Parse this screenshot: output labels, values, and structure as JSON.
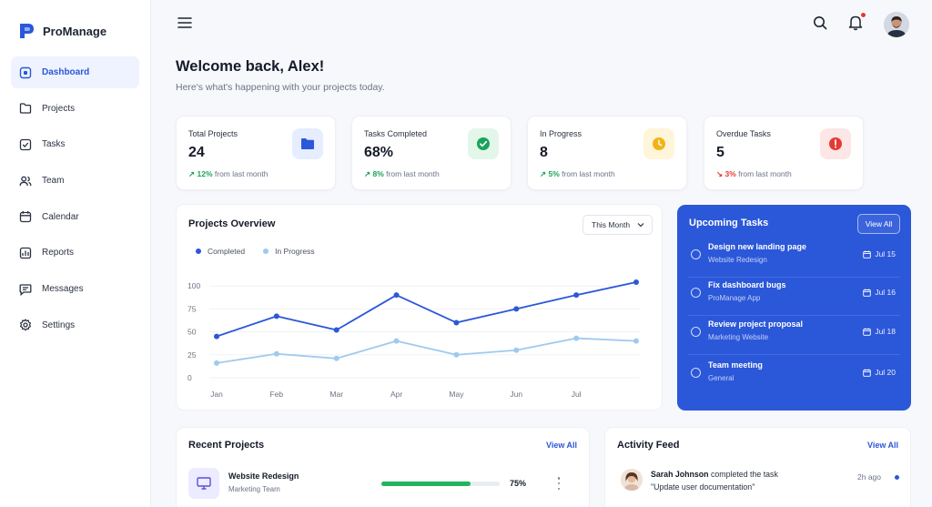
{
  "app": {
    "name": "ProManage"
  },
  "sidebar": {
    "items": [
      {
        "label": "Dashboard",
        "icon": "dashboard-icon",
        "active": true
      },
      {
        "label": "Projects",
        "icon": "folder-icon",
        "active": false
      },
      {
        "label": "Tasks",
        "icon": "check-square-icon",
        "active": false
      },
      {
        "label": "Team",
        "icon": "users-icon",
        "active": false
      },
      {
        "label": "Calendar",
        "icon": "calendar-icon",
        "active": false
      },
      {
        "label": "Reports",
        "icon": "chart-icon",
        "active": false
      },
      {
        "label": "Messages",
        "icon": "message-icon",
        "active": false
      },
      {
        "label": "Settings",
        "icon": "gear-icon",
        "active": false
      }
    ]
  },
  "header": {
    "welcome": "Welcome back, Alex!",
    "subtitle": "Here's what's happening with your projects today."
  },
  "stats": [
    {
      "label": "Total Projects",
      "value": "24",
      "delta": "12%",
      "delta_text": "from last month",
      "trend": "up",
      "icon": "folder-icon",
      "icon_bg": "#e6edff",
      "icon_color": "#2b57d9"
    },
    {
      "label": "Tasks Completed",
      "value": "68%",
      "delta": "8%",
      "delta_text": "from last month",
      "trend": "up",
      "icon": "check-circle-icon",
      "icon_bg": "#e3f6ea",
      "icon_color": "#1aa35a"
    },
    {
      "label": "In Progress",
      "value": "8",
      "delta": "5%",
      "delta_text": "from last month",
      "trend": "up",
      "icon": "clock-icon",
      "icon_bg": "#fff5d9",
      "icon_color": "#f2b316"
    },
    {
      "label": "Overdue Tasks",
      "value": "5",
      "delta": "3%",
      "delta_text": "from last month",
      "trend": "down",
      "icon": "alert-icon",
      "icon_bg": "#fde6e6",
      "icon_color": "#e53935"
    }
  ],
  "overview": {
    "title": "Projects Overview",
    "period": "This Month"
  },
  "chart_data": {
    "type": "line",
    "categories": [
      "Jan",
      "Feb",
      "Mar",
      "Apr",
      "May",
      "Jun",
      "Jul",
      ""
    ],
    "series": [
      {
        "name": "Completed",
        "color": "#2b57d9",
        "values": [
          45,
          67,
          52,
          90,
          60,
          75,
          90,
          104
        ]
      },
      {
        "name": "In Progress",
        "color": "#9fcaef",
        "values": [
          16,
          26,
          21,
          40,
          25,
          30,
          43,
          40
        ]
      }
    ],
    "yticks": [
      0,
      25,
      50,
      75,
      100
    ],
    "ylim": [
      0,
      110
    ],
    "legend": "top-left",
    "grid": true
  },
  "upcoming": {
    "title": "Upcoming Tasks",
    "view_all": "View All",
    "tasks": [
      {
        "name": "Design new landing page",
        "project": "Website Redesign",
        "date": "Jul 15"
      },
      {
        "name": "Fix dashboard bugs",
        "project": "ProManage App",
        "date": "Jul 16"
      },
      {
        "name": "Review project proposal",
        "project": "Marketing Website",
        "date": "Jul 18"
      },
      {
        "name": "Team meeting",
        "project": "General",
        "date": "Jul 20"
      }
    ]
  },
  "recent": {
    "title": "Recent Projects",
    "view_all": "View All",
    "projects": [
      {
        "name": "Website Redesign",
        "team": "Marketing Team",
        "progress": 75,
        "progress_label": "75%"
      }
    ]
  },
  "activity": {
    "title": "Activity Feed",
    "view_all": "View All",
    "items": [
      {
        "user": "Sarah Johnson",
        "action": "completed the task",
        "detail": "\"Update user documentation\"",
        "time": "2h ago"
      }
    ]
  }
}
